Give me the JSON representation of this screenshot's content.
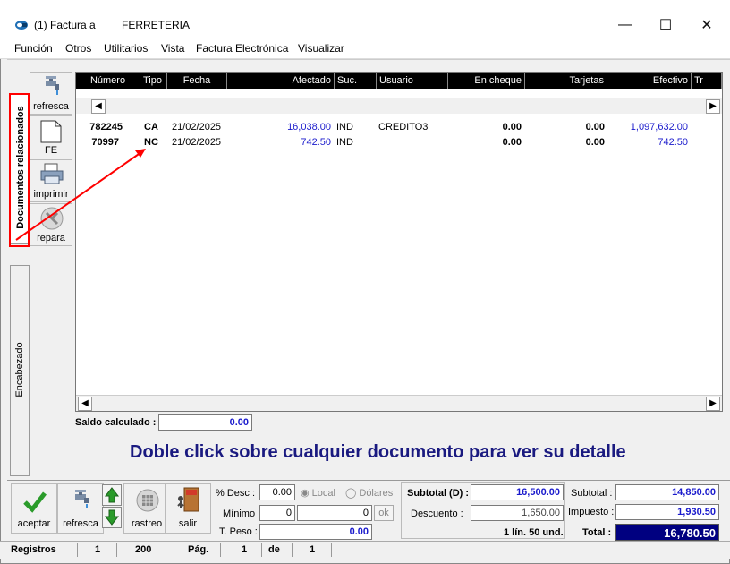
{
  "window": {
    "title": "(1) Factura a",
    "company": "FERRETERIA",
    "minimize": "—",
    "maximize": "☐",
    "close": "✕"
  },
  "menu": [
    "Función",
    "Otros",
    "Utilitarios",
    "Vista",
    "Factura Electrónica",
    "Visualizar"
  ],
  "side_tabs": {
    "docs": "Documentos relacionados",
    "header": "Encabezado"
  },
  "left_toolbar": {
    "refresca": "refresca",
    "fe": "FE",
    "imprimir": "imprimir",
    "repara": "repara"
  },
  "grid": {
    "columns": [
      "Número",
      "Tipo",
      "Fecha",
      "Afectado",
      "Suc.",
      "Usuario",
      "En cheque",
      "Tarjetas",
      "Efectivo",
      "Tr"
    ],
    "rows": [
      {
        "numero": "782245",
        "tipo": "CA",
        "fecha": "21/02/2025",
        "afectado": "16,038.00",
        "suc": "IND",
        "usuario": "CREDITO3",
        "cheque": "0.00",
        "tarjetas": "0.00",
        "efectivo": "1,097,632.00"
      },
      {
        "numero": "70997",
        "tipo": "NC",
        "fecha": "21/02/2025",
        "afectado": "742.50",
        "suc": "IND",
        "usuario": "",
        "cheque": "0.00",
        "tarjetas": "0.00",
        "efectivo": "742.50"
      }
    ]
  },
  "saldo": {
    "label": "Saldo calculado :",
    "value": "0.00"
  },
  "hint": "Doble click sobre cualquier documento para ver su detalle",
  "bottom_buttons": {
    "aceptar": "aceptar",
    "refresca": "refresca",
    "rastreo": "rastreo",
    "salir": "salir"
  },
  "discount": {
    "desc_label": "% Desc :",
    "desc_value": "0.00",
    "local": "Local",
    "dolares": "Dólares",
    "minimo_label": "Mínimo :",
    "minimo_value": "0",
    "minimo_value2": "0",
    "ok": "ok",
    "peso_label": "T. Peso :",
    "peso_value": "0.00"
  },
  "totals": {
    "subtotal_d_label": "Subtotal (D) :",
    "subtotal_d": "16,500.00",
    "descuento_label": "Descuento :",
    "descuento": "1,650.00",
    "lines": "1 lín. 50 und.",
    "subtotal_label": "Subtotal :",
    "subtotal": "14,850.00",
    "impuesto_label": "Impuesto :",
    "impuesto": "1,930.50",
    "total_label": "Total :",
    "total": "16,780.50"
  },
  "status": {
    "registros": "Registros",
    "reg1": "1",
    "reg2": "200",
    "pag": "Pág.",
    "page": "1",
    "de": "de",
    "pages": "1"
  },
  "colors": {
    "accent_blue": "#1a1acc",
    "total_bg": "#000080",
    "annotation": "#ff0000"
  }
}
